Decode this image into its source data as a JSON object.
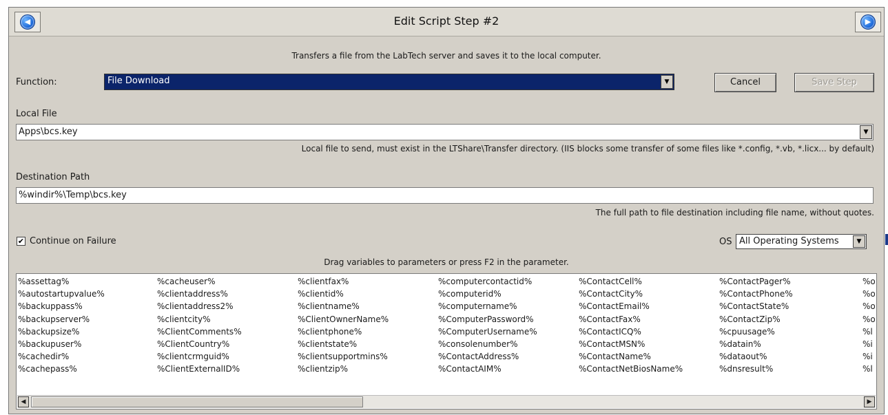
{
  "window": {
    "title": "Edit Script Step #2",
    "prev_icon": "back-arrow-icon",
    "next_icon": "forward-arrow-icon"
  },
  "description": "Transfers a file from the LabTech server and saves it to the local computer.",
  "function": {
    "label": "Function:",
    "value": "File Download"
  },
  "buttons": {
    "cancel": "Cancel",
    "save_step": "Save Step"
  },
  "local_file": {
    "label": "Local File",
    "value": "Apps\\bcs.key",
    "hint": "Local file to send, must exist in the LTShare\\Transfer directory.  (IIS blocks some transfer of some files like *.config, *.vb, *.licx... by default)"
  },
  "destination": {
    "label": "Destination Path",
    "value": "%windir%\\Temp\\bcs.key",
    "hint": "The full path to file destination including file name, without quotes."
  },
  "continue_on_failure": {
    "label": "Continue on Failure",
    "checked": true
  },
  "os": {
    "label": "OS",
    "value": "All Operating Systems"
  },
  "variables_hint": "Drag variables to parameters or press F2 in the parameter.",
  "variables": [
    [
      "%assettag%",
      "%autostartupvalue%",
      "%backuppass%",
      "%backupserver%",
      "%backupsize%",
      "%backupuser%",
      "%cachedir%",
      "%cachepass%"
    ],
    [
      "%cacheuser%",
      "%clientaddress%",
      "%clientaddress2%",
      "%clientcity%",
      "%ClientComments%",
      "%ClientCountry%",
      "%clientcrmguid%",
      "%ClientExternalID%"
    ],
    [
      "%clientfax%",
      "%clientid%",
      "%clientname%",
      "%ClientOwnerName%",
      "%clientphone%",
      "%clientstate%",
      "%clientsupportmins%",
      "%clientzip%"
    ],
    [
      "%computercontactid%",
      "%computerid%",
      "%computername%",
      "%ComputerPassword%",
      "%ComputerUsername%",
      "%consolenumber%",
      "%ContactAddress%",
      "%ContactAIM%"
    ],
    [
      "%ContactCell%",
      "%ContactCity%",
      "%ContactEmail%",
      "%ContactFax%",
      "%ContactICQ%",
      "%ContactMSN%",
      "%ContactName%",
      "%ContactNetBiosName%"
    ],
    [
      "%ContactPager%",
      "%ContactPhone%",
      "%ContactState%",
      "%ContactZip%",
      "%cpuusage%",
      "%datain%",
      "%dataout%",
      "%dnsresult%"
    ],
    [
      "%o",
      "%o",
      "%o",
      "%o",
      "%l",
      "%i",
      "%i",
      "%l"
    ]
  ],
  "colors": {
    "dialog_bg": "#d4d0c8",
    "selection_bg": "#0b246a"
  }
}
